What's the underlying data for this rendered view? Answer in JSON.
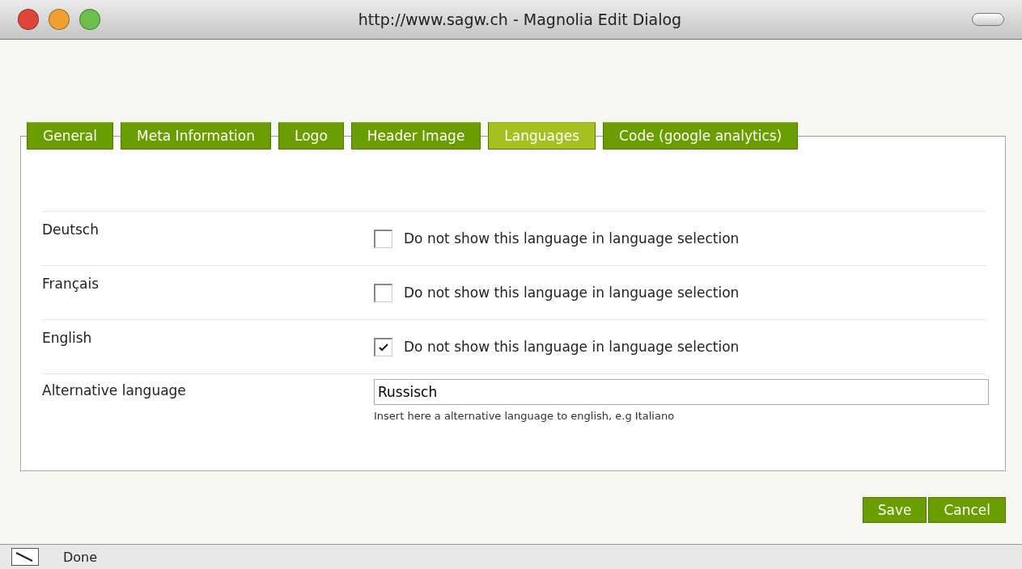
{
  "window": {
    "title": "http://www.sagw.ch - Magnolia Edit Dialog"
  },
  "tabs": [
    {
      "label": "General",
      "selected": false
    },
    {
      "label": "Meta Information",
      "selected": false
    },
    {
      "label": "Logo",
      "selected": false
    },
    {
      "label": "Header Image",
      "selected": false
    },
    {
      "label": "Languages",
      "selected": true
    },
    {
      "label": "Code (google analytics)",
      "selected": false
    }
  ],
  "rows": [
    {
      "kind": "checkbox",
      "label": "Deutsch",
      "option": "Do not show this language in language selection",
      "checked": false
    },
    {
      "kind": "checkbox",
      "label": "Français",
      "option": "Do not show this language in language selection",
      "checked": false
    },
    {
      "kind": "checkbox",
      "label": "English",
      "option": "Do not show this language in language selection",
      "checked": true
    },
    {
      "kind": "text",
      "label": "Alternative language",
      "value": "Russisch",
      "hint": "Insert here a alternative language to english, e.g Italiano"
    }
  ],
  "buttons": [
    "Save",
    "Cancel"
  ],
  "status_bar": {
    "text": "Done"
  }
}
